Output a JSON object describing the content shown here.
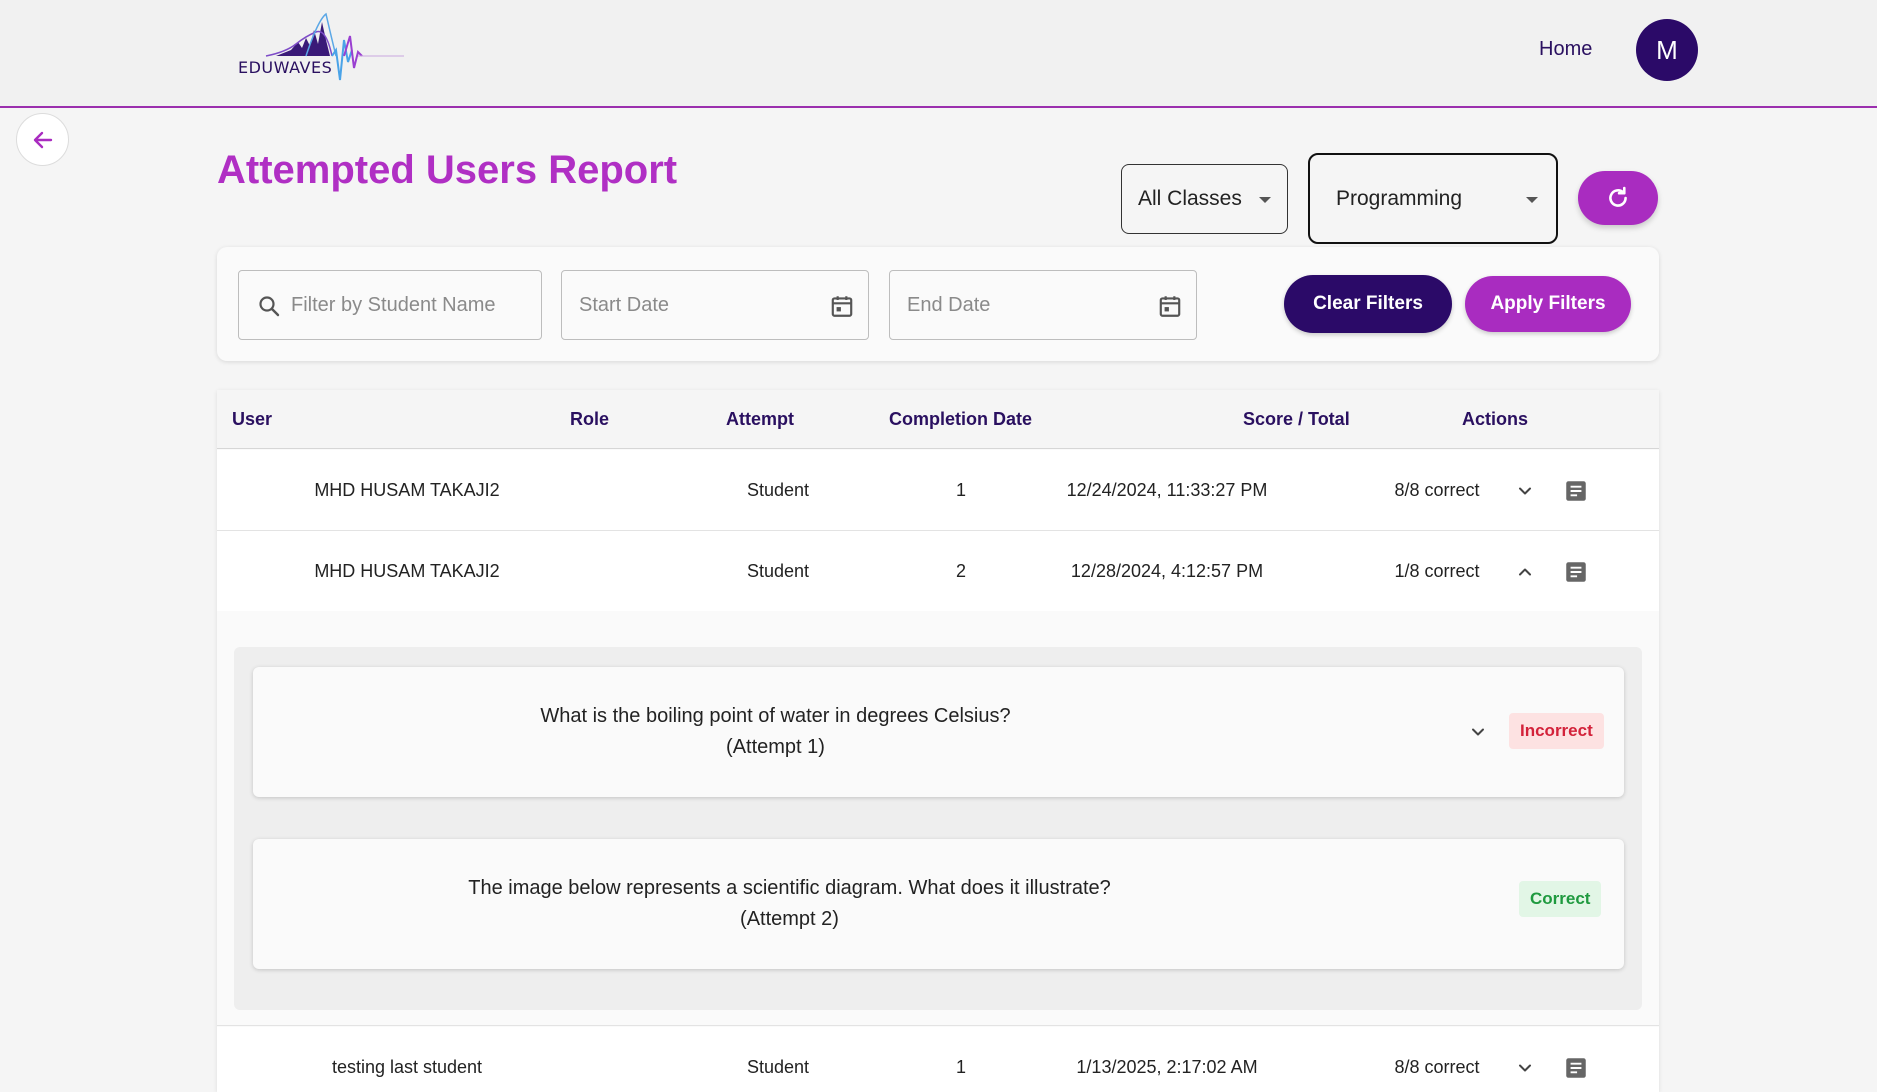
{
  "header": {
    "logo_text": "EDUWAVES",
    "nav_home": "Home",
    "avatar_initial": "M"
  },
  "page": {
    "title": "Attempted Users Report",
    "class_select": "All Classes",
    "subject_select": "Programming"
  },
  "filters": {
    "search_placeholder": "Filter by Student Name",
    "start_placeholder": "Start Date",
    "end_placeholder": "End Date",
    "clear_label": "Clear Filters",
    "apply_label": "Apply Filters"
  },
  "table": {
    "headers": [
      "User",
      "Role",
      "Attempt",
      "Completion Date",
      "Score / Total",
      "Actions"
    ],
    "rows": [
      {
        "user": "MHD HUSAM TAKAJI2",
        "role": "Student",
        "attempt": "1",
        "date": "12/24/2024, 11:33:27 PM",
        "score": "8/8 correct",
        "expanded": false
      },
      {
        "user": "MHD HUSAM TAKAJI2",
        "role": "Student",
        "attempt": "2",
        "date": "12/28/2024, 4:12:57 PM",
        "score": "1/8 correct",
        "expanded": true
      },
      {
        "user": "testing last student",
        "role": "Student",
        "attempt": "1",
        "date": "1/13/2025, 2:17:02 AM",
        "score": "8/8 correct",
        "expanded": false
      }
    ]
  },
  "detail": {
    "questions": [
      {
        "text": "What is the boiling point of water in degrees Celsius?",
        "attempt": "(Attempt 1)",
        "status": "Incorrect"
      },
      {
        "text": "The image below represents a scientific diagram. What does it illustrate?",
        "attempt": "(Attempt 2)",
        "status": "Correct"
      }
    ]
  },
  "colors": {
    "brand_purple": "#a92cc0",
    "brand_dark": "#2b0a68",
    "incorrect": "#d3223a",
    "correct": "#1f9a3f"
  },
  "icons": [
    "back-arrow-icon",
    "refresh-icon",
    "search-icon",
    "calendar-icon",
    "chevron-down-icon",
    "chevron-up-icon",
    "document-icon"
  ]
}
